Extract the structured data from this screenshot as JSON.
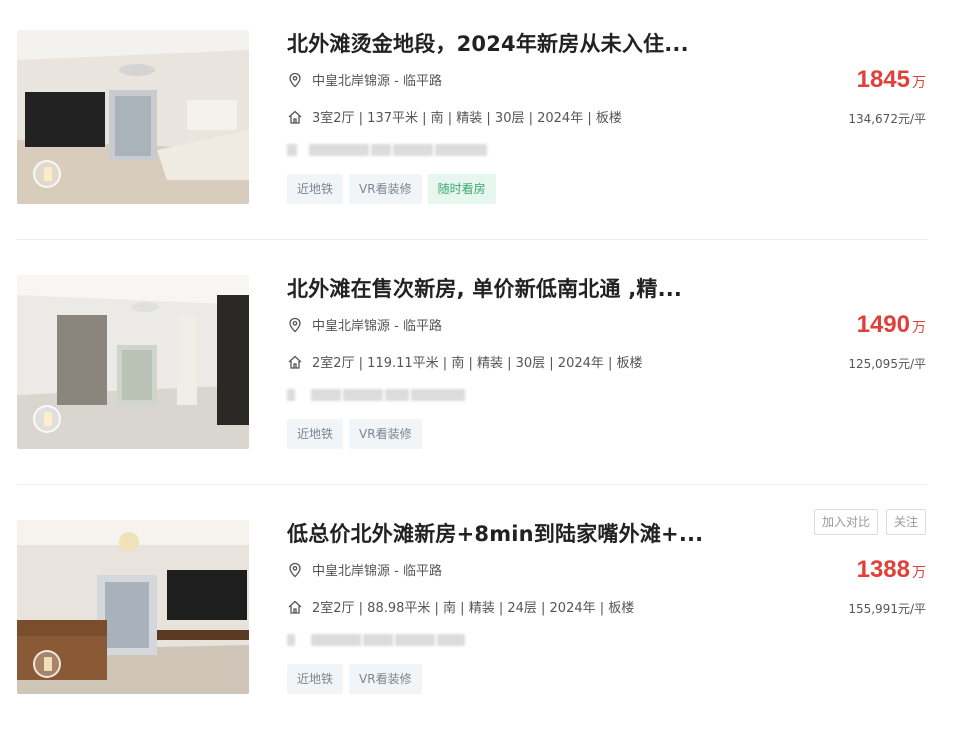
{
  "listings": [
    {
      "title": "北外滩烫金地段，2024年新房从未入住...",
      "address": "中皇北岸锦源 - 临平路",
      "info": "3室2厅 | 137平米 | 南 | 精装 | 30层 | 2024年 | 板楼",
      "price": "1845",
      "price_unit": "万",
      "unit_price": "134,672元/平",
      "tags": [
        "近地铁",
        "VR看装修",
        "随时看房"
      ],
      "image_icon": "vr-badge-icon"
    },
    {
      "title": "北外滩在售次新房, 单价新低南北通 ,精...",
      "address": "中皇北岸锦源 - 临平路",
      "info": "2室2厅 | 119.11平米 | 南 | 精装 | 30层 | 2024年 | 板楼",
      "price": "1490",
      "price_unit": "万",
      "unit_price": "125,095元/平",
      "tags": [
        "近地铁",
        "VR看装修"
      ],
      "image_icon": "vr-badge-icon"
    },
    {
      "title": "低总价北外滩新房+8min到陆家嘴外滩+...",
      "address": "中皇北岸锦源 - 临平路",
      "info": "2室2厅 | 88.98平米 | 南 | 精装 | 24层 | 2024年 | 板楼",
      "price": "1388",
      "price_unit": "万",
      "unit_price": "155,991元/平",
      "tags": [
        "近地铁",
        "VR看装修"
      ],
      "actions": [
        "加入对比",
        "关注"
      ],
      "image_icon": "vr-badge-icon"
    }
  ],
  "icons": {
    "address": "location-pin-icon",
    "info": "house-icon"
  },
  "colors": {
    "price": "#e0403a",
    "tag_green": "#3ba871",
    "tag_gray": "#7a8590"
  }
}
